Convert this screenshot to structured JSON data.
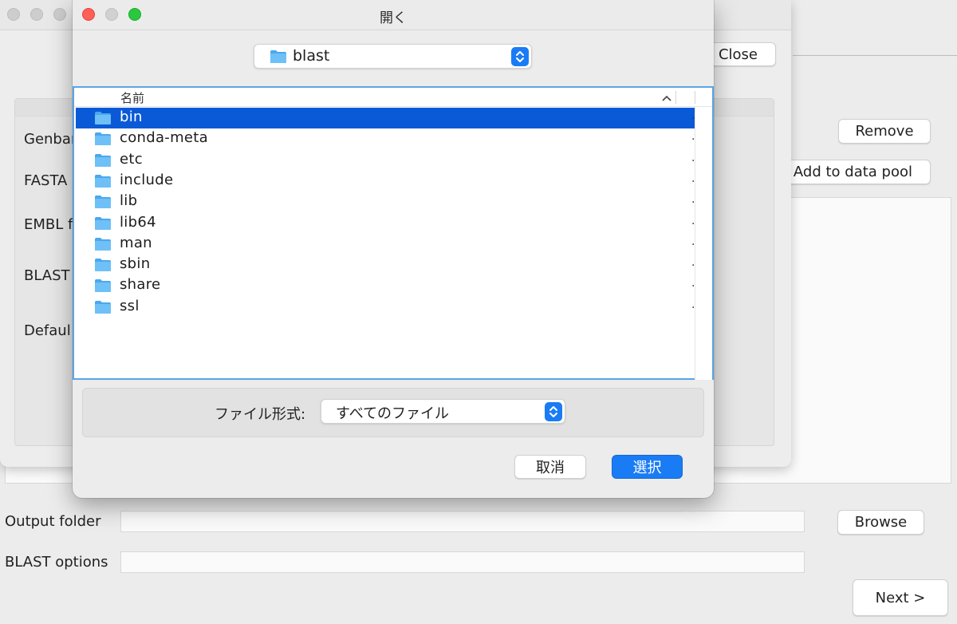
{
  "main_window": {
    "remove_label": "Remove",
    "add_to_pool_label": "Add to data pool",
    "output_folder_label": "Output folder",
    "output_folder_value": "",
    "browse_label": "Browse",
    "blast_options_label": "BLAST options",
    "blast_options_value": "",
    "next_label": "Next >"
  },
  "middle_window": {
    "close_label": "Close",
    "labels": [
      "Genbar",
      "FASTA",
      "EMBL f",
      "BLAST",
      "Defaul"
    ]
  },
  "dialog": {
    "title": "開く",
    "location": "blast",
    "column_header": "名前",
    "items": [
      {
        "name": "bin",
        "selected": true
      },
      {
        "name": "conda-meta",
        "selected": false
      },
      {
        "name": "etc",
        "selected": false
      },
      {
        "name": "include",
        "selected": false
      },
      {
        "name": "lib",
        "selected": false
      },
      {
        "name": "lib64",
        "selected": false
      },
      {
        "name": "man",
        "selected": false
      },
      {
        "name": "sbin",
        "selected": false
      },
      {
        "name": "share",
        "selected": false
      },
      {
        "name": "ssl",
        "selected": false
      }
    ],
    "row_suffix": ".",
    "format_label": "ファイル形式:",
    "format_value": "すべてのファイル",
    "cancel_label": "取消",
    "ok_label": "選択",
    "accent_color": "#1a7cf5",
    "selection_color": "#0a5ad8"
  }
}
